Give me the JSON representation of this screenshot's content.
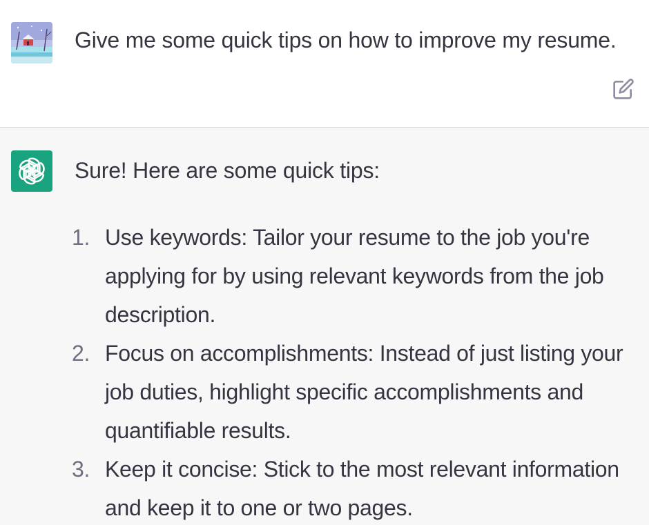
{
  "user_message": {
    "text": "Give me some quick tips on how to improve my resume.",
    "edit_icon": "edit-icon"
  },
  "assistant_message": {
    "intro": "Sure! Here are some quick tips:",
    "tips": [
      {
        "number": "1.",
        "text": "Use keywords: Tailor your resume to the job you're applying for by using relevant keywords from the job description."
      },
      {
        "number": "2.",
        "text": "Focus on accomplishments: Instead of just listing your job duties, highlight specific accomplishments and quantifiable results."
      },
      {
        "number": "3.",
        "text": "Keep it concise: Stick to the most relevant information and keep it to one or two pages."
      }
    ]
  },
  "colors": {
    "assistant_avatar_bg": "#19a37f",
    "assistant_bg": "#f7f7f8",
    "text": "#343541"
  }
}
